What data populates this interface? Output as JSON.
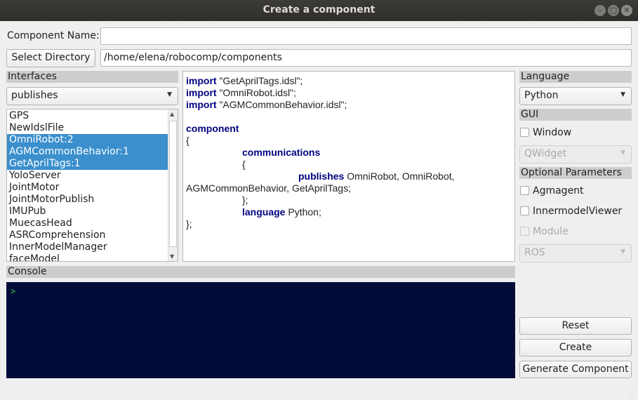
{
  "window": {
    "title": "Create a component"
  },
  "component_name": {
    "label": "Component Name:",
    "value": ""
  },
  "directory": {
    "button": "Select Directory",
    "path": "/home/elena/robocomp/components"
  },
  "interfaces": {
    "header": "Interfaces",
    "mode": "publishes",
    "items": [
      {
        "label": "GPS",
        "selected": false
      },
      {
        "label": "NewIdslFile",
        "selected": false
      },
      {
        "label": "OmniRobot:2",
        "selected": true
      },
      {
        "label": "AGMCommonBehavior:1",
        "selected": true
      },
      {
        "label": "GetAprilTags:1",
        "selected": true
      },
      {
        "label": "YoloServer",
        "selected": false
      },
      {
        "label": "JointMotor",
        "selected": false
      },
      {
        "label": "JointMotorPublish",
        "selected": false
      },
      {
        "label": "IMUPub",
        "selected": false
      },
      {
        "label": "MuecasHead",
        "selected": false
      },
      {
        "label": "ASRComprehension",
        "selected": false
      },
      {
        "label": "InnerModelManager",
        "selected": false
      },
      {
        "label": "faceModel",
        "selected": false
      }
    ]
  },
  "code": {
    "import_kw": "import",
    "imports": [
      "\"GetAprilTags.idsl\";",
      "\"OmniRobot.idsl\";",
      "\"AGMCommonBehavior.idsl\";"
    ],
    "component_kw": "component",
    "open_brace": "{",
    "communications_kw": "communications",
    "inner_open": "{",
    "publishes_kw": "publishes",
    "publishes_list_1": "OmniRobot, OmniRobot,",
    "publishes_list_2": "AGMCommonBehavior, GetAprilTags;",
    "inner_close": "};",
    "language_kw": "language",
    "language_value": "Python;",
    "close": "};"
  },
  "language": {
    "header": "Language",
    "value": "Python"
  },
  "gui": {
    "header": "GUI",
    "window_label": "Window",
    "widget_value": "QWidget"
  },
  "optional": {
    "header": "Optional Parameters",
    "agmagent": "Agmagent",
    "innermodel": "InnermodelViewer",
    "module": "Module",
    "module_value": "ROS"
  },
  "console": {
    "header": "Console",
    "prompt": ">"
  },
  "buttons": {
    "reset": "Reset",
    "create": "Create",
    "generate": "Generate Component"
  },
  "colors": {
    "selection": "#3a8fcc",
    "keyword": "#000080",
    "console_bg": "#030c38",
    "console_text": "#38c438"
  },
  "icons": [
    "minimize-icon",
    "maximize-icon",
    "close-icon",
    "chevron-down-icon",
    "resize-grip-icon"
  ]
}
